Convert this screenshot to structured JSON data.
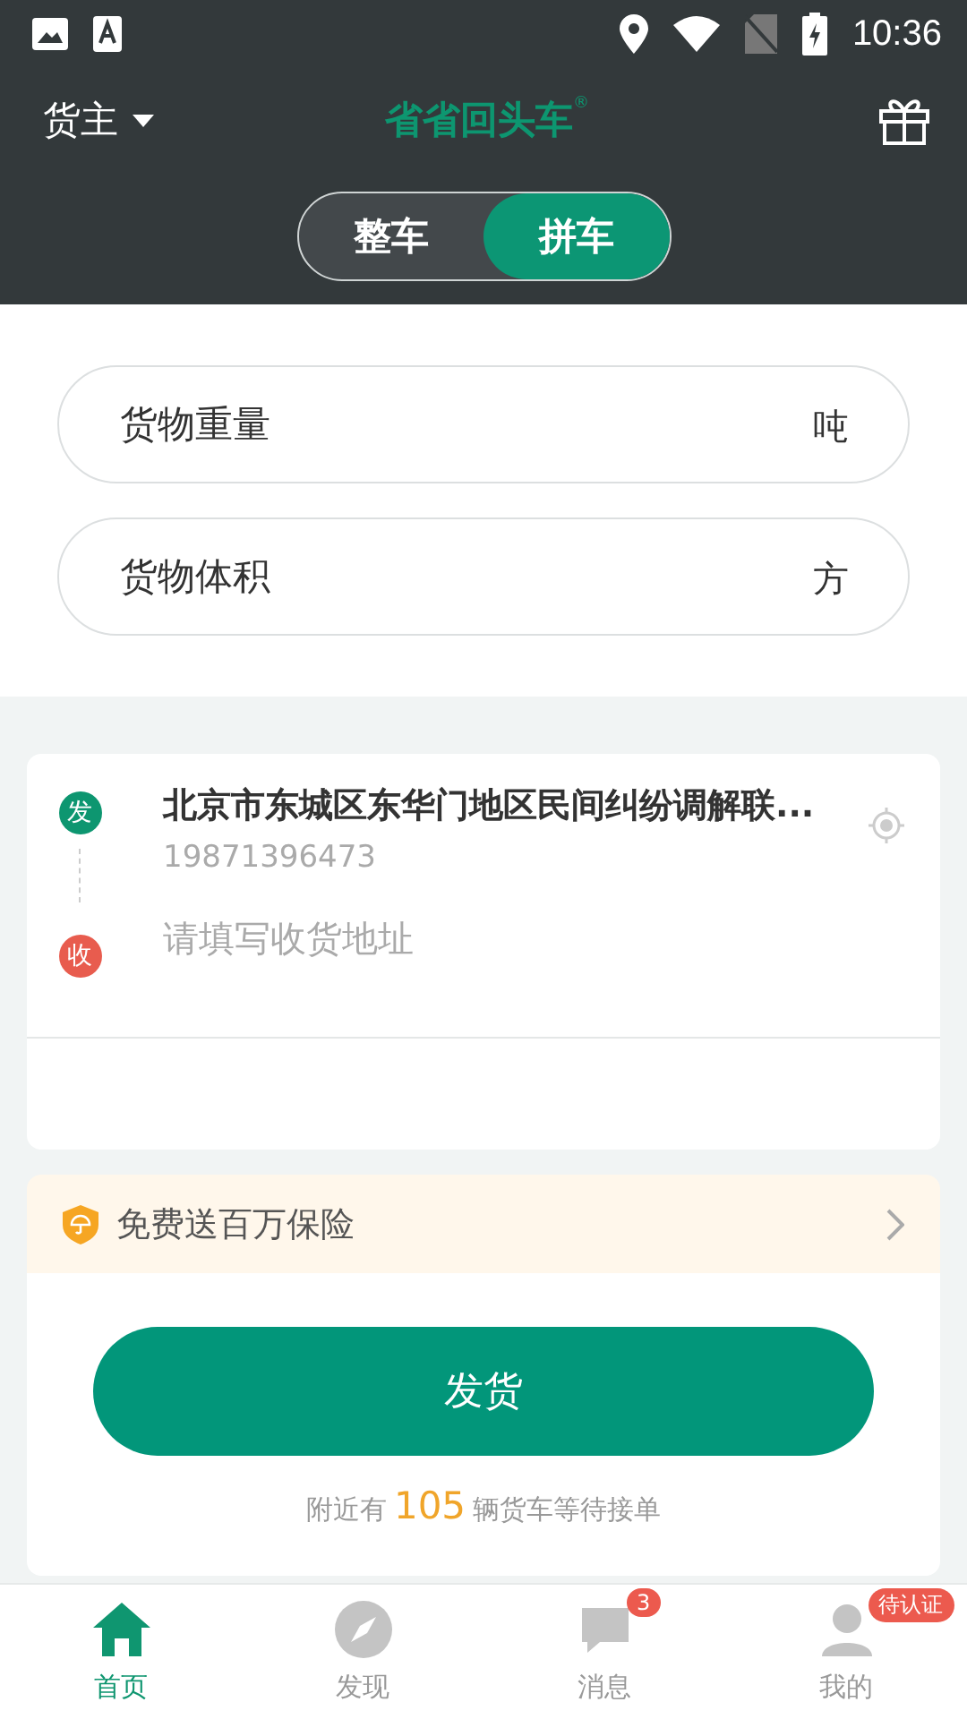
{
  "status_bar": {
    "time": "10:36"
  },
  "header": {
    "role": "货主",
    "logo": "省省回头车",
    "logo_mark": "®"
  },
  "mode_tabs": [
    {
      "label": "整车",
      "selected": false
    },
    {
      "label": "拼车",
      "selected": true
    }
  ],
  "fields": [
    {
      "placeholder": "货物重量",
      "unit": "吨"
    },
    {
      "placeholder": "货物体积",
      "unit": "方"
    }
  ],
  "route": {
    "from_badge": "发",
    "from_address": "北京市东城区东华门地区民间纠纷调解联...",
    "from_phone": "19871396473",
    "to_badge": "收",
    "to_placeholder": "请填写收货地址"
  },
  "insurance": {
    "label": "免费送百万保险"
  },
  "ship_button": "发货",
  "nearby": {
    "prefix": "附近有",
    "count": "105",
    "suffix": "辆货车等待接单"
  },
  "nav": [
    {
      "label": "首页",
      "selected": true,
      "kind": "home"
    },
    {
      "label": "发现",
      "selected": false,
      "kind": "discover"
    },
    {
      "label": "消息",
      "selected": false,
      "kind": "message",
      "badge": "3"
    },
    {
      "label": "我的",
      "selected": false,
      "kind": "me",
      "badge": "待认证"
    }
  ]
}
